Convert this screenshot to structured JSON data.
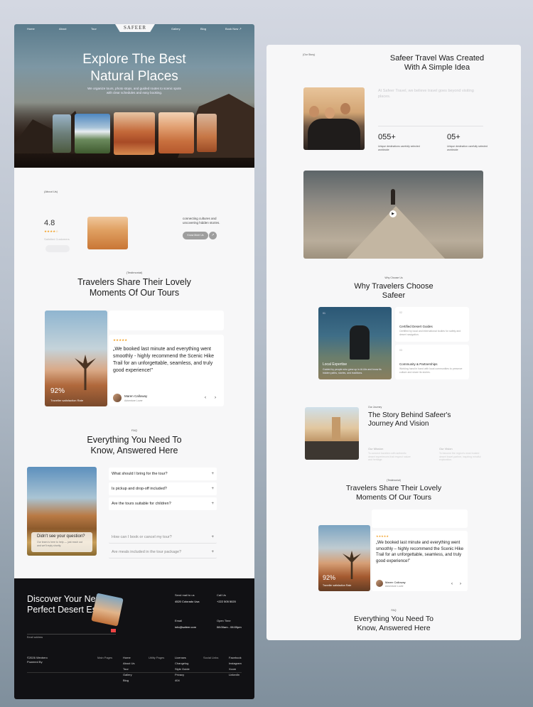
{
  "nav": {
    "logo": "SAFEER",
    "items": [
      "Home",
      "About",
      "Tour",
      "Gallery",
      "Blog"
    ],
    "cta": "Book Now ↗"
  },
  "hero": {
    "title_line1": "Explore The Best",
    "title_line2": "Natural Places",
    "subtitle": "We organize tours, photo stops, and guided routes to scenic spots with clear schedules and easy booking."
  },
  "about": {
    "tag": "(About Us)",
    "rating": "4.8",
    "stars": "★★★★☆",
    "rating_label": "Satisfied Customers",
    "text": "connecting cultures and uncovering hidden stories.",
    "button": "Know More Us",
    "arrow": "↗"
  },
  "testimonials_left": {
    "tag": "(Testimonial)",
    "title_line1": "Travelers Share Their Lovely",
    "title_line2": "Moments Of Our Tours",
    "percent": "92%",
    "percent_label": "Traveller satisfaction Rate",
    "stars": "★★★★★",
    "quote": "„We booked last minute and everything went smoothly - highly recommend the Scenic Hike Trail for an unforgettable, seamless, and truly good experience!”",
    "author": "Maren Calloway",
    "author_role": "Adventure Lover",
    "prev": "‹",
    "next": "›"
  },
  "faq": {
    "tag": "FAQ",
    "title_line1": "Everything You Need To",
    "title_line2": "Know, Answered Here",
    "items": [
      "What should I bring for the tour?",
      "Is pickup and drop-off included?",
      "Are the tours suitable for children?",
      "How can I book or cancel my tour?",
      "Are meals included in the tour package?"
    ],
    "plus": "+",
    "photo_title": "Didn't see your question?",
    "photo_text": "Our team is here to help — just reach out and we'll reply shortly."
  },
  "footer": {
    "title_line1": "Discover Your Next",
    "title_line2": "Perfect Desert Escape",
    "email_label": "Email address",
    "send_label": "Send mail to us",
    "address": "4520 Colorado Usa",
    "call_label": "Call Us",
    "phone": "+222 505 5020",
    "email_title": "Email",
    "email": "info@safeer.com",
    "open_label": "Open Time",
    "hours": "08:00am - 06:00pm",
    "copyright": "©2026 Wexbero",
    "powered": "Powered By",
    "main_pages_label": "Main Pages",
    "main_pages": [
      "Home",
      "About Us",
      "Tour",
      "Gallery",
      "Blog"
    ],
    "utility_label": "Utility Pages",
    "utility": [
      "Licenses",
      "Changelog",
      "Style Guide",
      "Privacy",
      "404"
    ],
    "social_label": "Social Links",
    "social": [
      "Facebook",
      "Instagram",
      "Xcom",
      "LinkedIn"
    ]
  },
  "right_about": {
    "tag": "(Our Story)",
    "title_line1": "Safeer Travel Was Created",
    "title_line2": "With A Simple Idea",
    "text": "At Safeer Travel, we believe travel goes beyond visiting places.",
    "stat1_value": "055+",
    "stat1_label": "Unique destinations carefully selected worldwide",
    "stat2_value": "05+",
    "stat2_label": "Unique destination carefully selected worldwide"
  },
  "why": {
    "tag": "Why Choose Us",
    "title_line1": "Why Travelers Choose",
    "title_line2": "Safeer",
    "card_title": "Local Expertise",
    "card_text": "Guided by people who grew up in Al-Ula and know its hidden paths, stories, and traditions.",
    "num1": "01",
    "num2": "02",
    "num3": "03",
    "feat1_title": "Certified Desert Guides",
    "feat1_text": "Certified by local and international bodies for safety and desert navigation.",
    "feat2_title": "Community & Partnerships",
    "feat2_text": "Working hand in hand with local communities to preserve culture and share its stories."
  },
  "story": {
    "tag": "Our Journey",
    "title_line1": "The Story Behind Safeer's",
    "title_line2": "Journey And Vision",
    "mission_title": "Our Mission",
    "mission_text": "To connect travelers with authentic desert experiences that respect nature and heritage.",
    "vision_title": "Our Vision",
    "vision_text": "To become the region's most trusted desert travel partner, inspiring mindful exploration."
  },
  "testimonials_right": {
    "tag": "(Testimonial)",
    "title_line1": "Travelers Share Their Lovely",
    "title_line2": "Moments Of Our Tours",
    "percent": "92%",
    "percent_label": "Traveller satisfaction Rate",
    "stars": "★★★★★",
    "quote": "„We booked last minute and everything went smoothly – highly recommend the Scenic Hike Trail for an unforgettable, seamless, and truly good experience!”",
    "author": "Maren Calloway",
    "author_role": "Adventure Lover",
    "prev": "‹",
    "next": "›"
  },
  "faq_right": {
    "tag": "FAQ",
    "title_line1": "Everything You Need To",
    "title_line2": "Know, Answered Here"
  }
}
